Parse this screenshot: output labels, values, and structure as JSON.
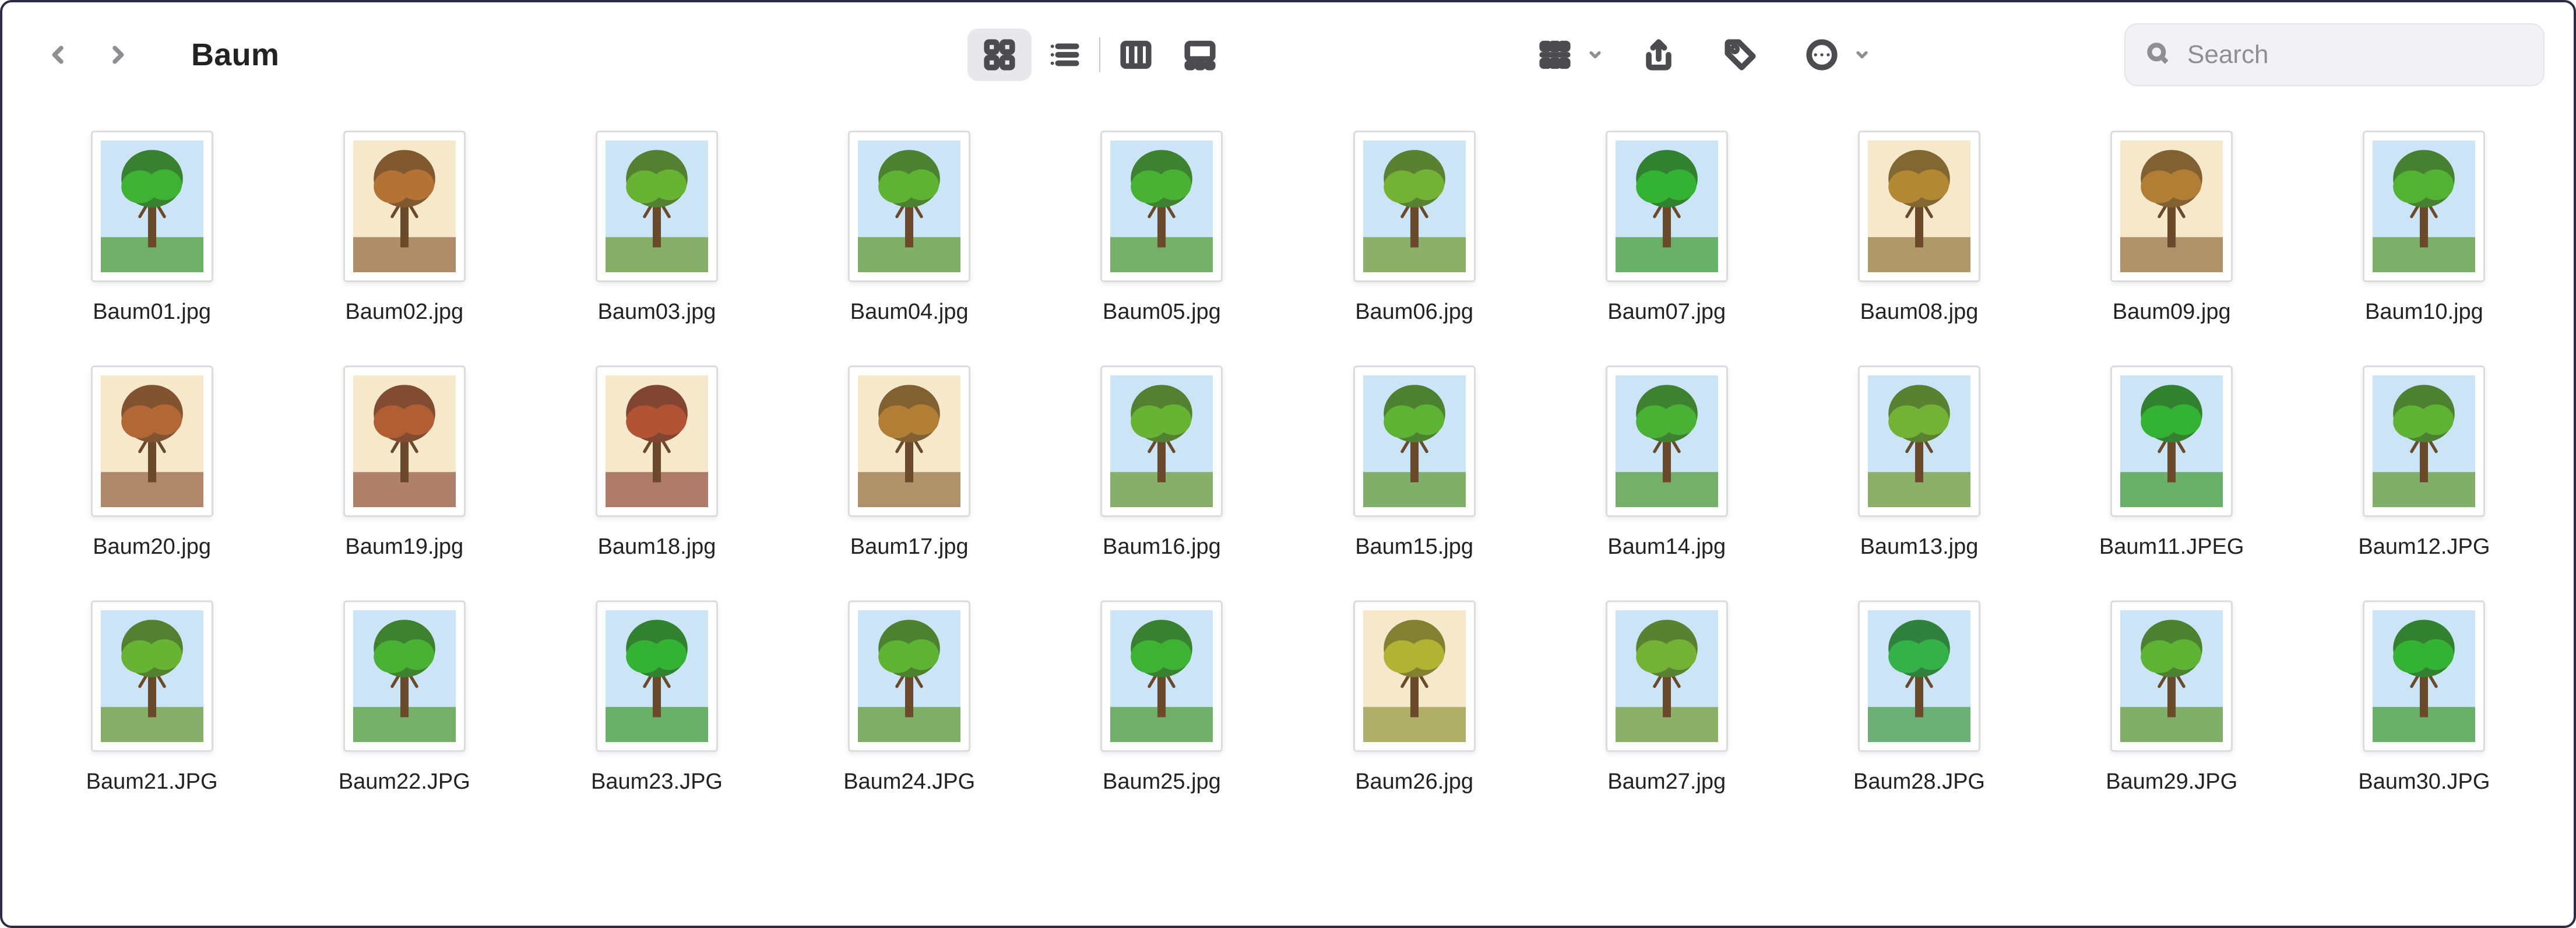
{
  "header": {
    "title": "Baum"
  },
  "search": {
    "placeholder": "Search"
  },
  "files": [
    {
      "name": "Baum01.jpg",
      "hue": 115
    },
    {
      "name": "Baum02.jpg",
      "hue": 30
    },
    {
      "name": "Baum03.jpg",
      "hue": 95
    },
    {
      "name": "Baum04.jpg",
      "hue": 100
    },
    {
      "name": "Baum05.jpg",
      "hue": 110
    },
    {
      "name": "Baum06.jpg",
      "hue": 90
    },
    {
      "name": "Baum07.jpg",
      "hue": 120
    },
    {
      "name": "Baum08.jpg",
      "hue": 40
    },
    {
      "name": "Baum09.jpg",
      "hue": 35
    },
    {
      "name": "Baum10.jpg",
      "hue": 105
    },
    {
      "name": "Baum20.jpg",
      "hue": 25
    },
    {
      "name": "Baum19.jpg",
      "hue": 20
    },
    {
      "name": "Baum18.jpg",
      "hue": 15
    },
    {
      "name": "Baum17.jpg",
      "hue": 35
    },
    {
      "name": "Baum16.jpg",
      "hue": 95
    },
    {
      "name": "Baum15.jpg",
      "hue": 100
    },
    {
      "name": "Baum14.jpg",
      "hue": 110
    },
    {
      "name": "Baum13.jpg",
      "hue": 90
    },
    {
      "name": "Baum11.JPEG",
      "hue": 120
    },
    {
      "name": "Baum12.JPG",
      "hue": 100
    },
    {
      "name": "Baum21.JPG",
      "hue": 95
    },
    {
      "name": "Baum22.JPG",
      "hue": 110
    },
    {
      "name": "Baum23.JPG",
      "hue": 120
    },
    {
      "name": "Baum24.JPG",
      "hue": 100
    },
    {
      "name": "Baum25.jpg",
      "hue": 115
    },
    {
      "name": "Baum26.jpg",
      "hue": 60
    },
    {
      "name": "Baum27.jpg",
      "hue": 90
    },
    {
      "name": "Baum28.JPG",
      "hue": 130
    },
    {
      "name": "Baum29.JPG",
      "hue": 100
    },
    {
      "name": "Baum30.JPG",
      "hue": 120
    }
  ]
}
